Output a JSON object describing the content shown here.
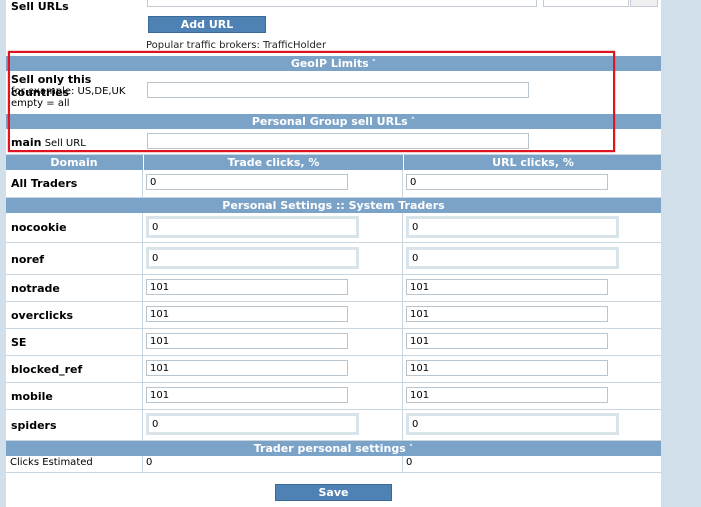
{
  "sell_urls": {
    "label": "Sell URLs",
    "add_url_label": "Add URL",
    "brokers_text": "Popular traffic brokers: TrafficHolder"
  },
  "geoip": {
    "title": "GeoIP Limits",
    "chevron": "up",
    "label": "Sell only this countries",
    "hint1": "for example: US,DE,UK",
    "hint2": "empty = all",
    "value": ""
  },
  "personal_group": {
    "title": "Personal Group sell URLs",
    "chevron": "up",
    "label_bold": "main",
    "label_rest": "Sell URL",
    "value": ""
  },
  "columns": {
    "domain": "Domain",
    "trade": "Trade clicks, %",
    "url": "URL clicks, %"
  },
  "all_traders": {
    "label": "All Traders",
    "trade": "0",
    "url": "0"
  },
  "system_traders": {
    "title": "Personal Settings :: System Traders",
    "rows": [
      {
        "label": "nocookie",
        "trade": "0",
        "url": "0"
      },
      {
        "label": "noref",
        "trade": "0",
        "url": "0"
      },
      {
        "label": "notrade",
        "trade": "101",
        "url": "101"
      },
      {
        "label": "overclicks",
        "trade": "101",
        "url": "101"
      },
      {
        "label": "SE",
        "trade": "101",
        "url": "101"
      },
      {
        "label": "blocked_ref",
        "trade": "101",
        "url": "101"
      },
      {
        "label": "mobile",
        "trade": "101",
        "url": "101"
      },
      {
        "label": "spiders",
        "trade": "0",
        "url": "0"
      }
    ]
  },
  "trader_personal": {
    "title": "Trader personal settings",
    "chevron": "down",
    "clicks_label": "Clicks Estimated",
    "trade": "0",
    "url": "0"
  },
  "save_label": "Save",
  "colors": {
    "header": "#7ba3c8",
    "button": "#4e82b4",
    "highlight": "#e0141e"
  }
}
